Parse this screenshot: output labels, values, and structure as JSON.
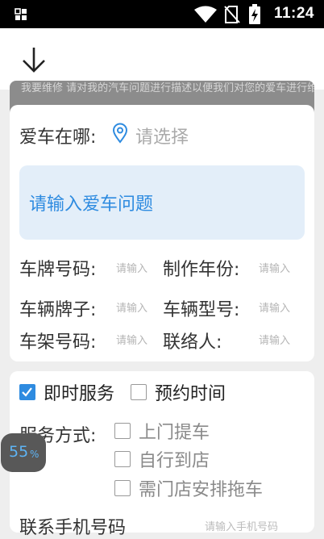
{
  "status_bar": {
    "time": "11:24"
  },
  "banner": {
    "text": "我要维修 请对我的汽车问题进行描述以便我们对您的爱车进行维修"
  },
  "location": {
    "label": "爱车在哪:",
    "placeholder": "请选择"
  },
  "problem": {
    "placeholder": "请输入爱车问题"
  },
  "fields": [
    {
      "label": "车牌号码:",
      "placeholder": "请输入"
    },
    {
      "label": "制作年份:",
      "placeholder": "请输入"
    },
    {
      "label": "车辆牌子:",
      "placeholder": "请输入"
    },
    {
      "label": "车辆型号:",
      "placeholder": "请输入"
    },
    {
      "label": "车架号码:",
      "placeholder": "请输入"
    },
    {
      "label": "联络人:",
      "placeholder": "请输入"
    }
  ],
  "service_time": {
    "options": [
      {
        "label": "即时服务",
        "checked": true
      },
      {
        "label": "预约时间",
        "checked": false
      }
    ]
  },
  "service_method": {
    "label": "服务方式:",
    "options": [
      {
        "label": "上门提车",
        "checked": false
      },
      {
        "label": "自行到店",
        "checked": false
      },
      {
        "label": "需门店安排拖车",
        "checked": false
      }
    ]
  },
  "floating_badge": {
    "value": "55",
    "unit": "%"
  },
  "partial_row": {
    "label": "联系手机号码",
    "placeholder": "请输入手机号码"
  },
  "colors": {
    "accent": "#2e8be0",
    "status_bar": "#000000",
    "page_bg": "#eeeeee"
  }
}
